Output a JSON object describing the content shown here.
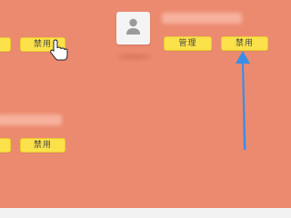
{
  "rows": [
    {
      "manage_label": "管理",
      "disable_label_left": "禁用",
      "disable_label_right": "禁用"
    },
    {
      "disable_label": "禁用"
    }
  ],
  "icons": {
    "avatar": "user-avatar-icon",
    "cursor": "hand-pointer-icon",
    "arrow": "blue-arrow-icon"
  },
  "colors": {
    "background": "#ec8a70",
    "button": "#fbe14a",
    "arrow": "#3a8ee6"
  }
}
